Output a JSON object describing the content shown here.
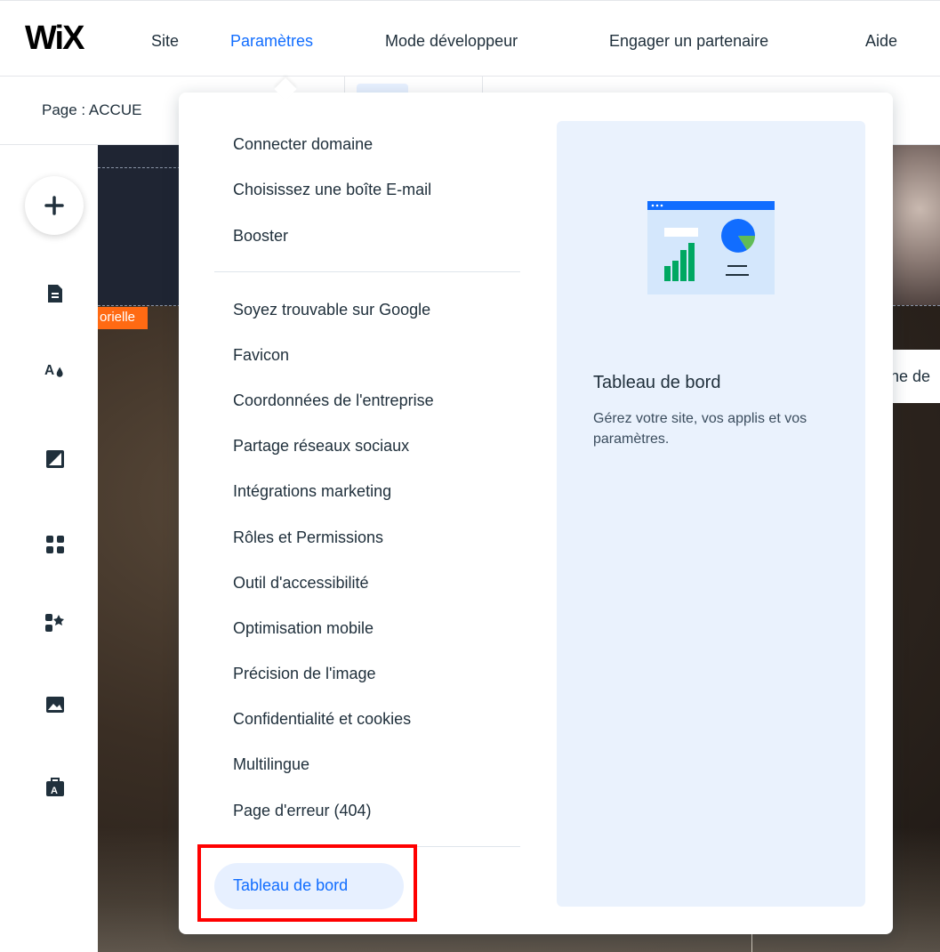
{
  "app": {
    "logo": "WiX"
  },
  "nav": [
    {
      "label": "Site",
      "active": false
    },
    {
      "label": "Paramètres",
      "active": true
    },
    {
      "label": "Mode développeur",
      "active": false
    },
    {
      "label": "Engager un partenaire",
      "active": false
    },
    {
      "label": "Aide",
      "active": false
    }
  ],
  "subbar": {
    "page_label": "Page : ACCUE"
  },
  "canvas": {
    "tag": "orielle",
    "right_text": "ne de"
  },
  "menu": {
    "group1": [
      "Connecter domaine",
      "Choisissez une boîte E-mail",
      "Booster"
    ],
    "group2": [
      "Soyez trouvable sur Google",
      "Favicon",
      "Coordonnées de l'entreprise",
      "Partage réseaux sociaux",
      "Intégrations marketing",
      "Rôles et Permissions",
      "Outil d'accessibilité",
      "Optimisation mobile",
      "Précision de l'image",
      "Confidentialité et cookies",
      "Multilingue",
      "Page d'erreur (404)"
    ],
    "dashboard": "Tableau de bord"
  },
  "preview": {
    "title": "Tableau de bord",
    "description": "Gérez votre site, vos applis et vos paramètres."
  },
  "colors": {
    "accent": "#116dff",
    "highlight": "#ff0000",
    "tag": "#ff6a13",
    "preview_bg": "#eaf2fd"
  }
}
